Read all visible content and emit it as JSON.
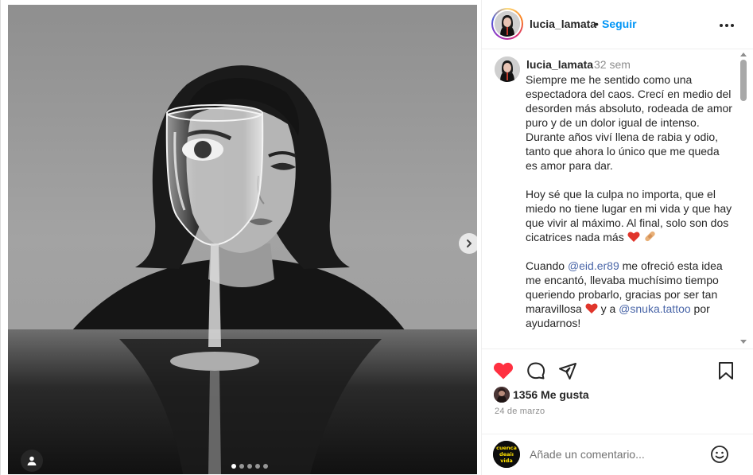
{
  "post": {
    "username": "lucia_lamata",
    "separator": "•",
    "follow_label": "Seguir",
    "caption": {
      "username": "lucia_lamata",
      "time": "32 sem",
      "p1": "Siempre me he sentido como una espectadora del caos. Crecí en medio del desorden más absoluto, rodeada de amor puro y de un dolor igual de intenso. Durante años viví llena de rabia y odio, tanto que ahora lo único que me queda es amor para dar.",
      "p2": "Hoy sé que la culpa no importa, que el miedo no tiene lugar en mi vida y que hay que vivir al máximo. Al final, solo son dos cicatrices nada más",
      "p3_a": "Cuando ",
      "mention1": "@eid.er89",
      "p3_b": " me ofreció esta idea me encantó, llevaba muchísimo tiempo queriendo probarlo, gracias por ser tan maravillosa ",
      "p3_c": " y a ",
      "mention2": "@snuka.tattoo",
      "p3_d": " por ayudarnos!"
    },
    "likes": "1356 Me gusta",
    "date": "24 de marzo",
    "comment_placeholder": "Añade un comentario...",
    "commenter_avatar_text": "cuencadeaividavida",
    "carousel": {
      "count": 5,
      "active_index": 0
    },
    "liked": true
  },
  "icons": {
    "like": "heart-filled-icon",
    "comment": "comment-bubble-icon",
    "share": "paper-plane-icon",
    "save": "bookmark-icon",
    "more": "more-dots-icon",
    "next": "chevron-right-icon",
    "tag": "user-tag-icon",
    "emoji": "smiley-icon"
  },
  "colors": {
    "accent": "#0095f6",
    "like_red": "#ff3040",
    "mention": "#4a66a8",
    "text": "#262626",
    "muted": "#8e8e8e"
  }
}
